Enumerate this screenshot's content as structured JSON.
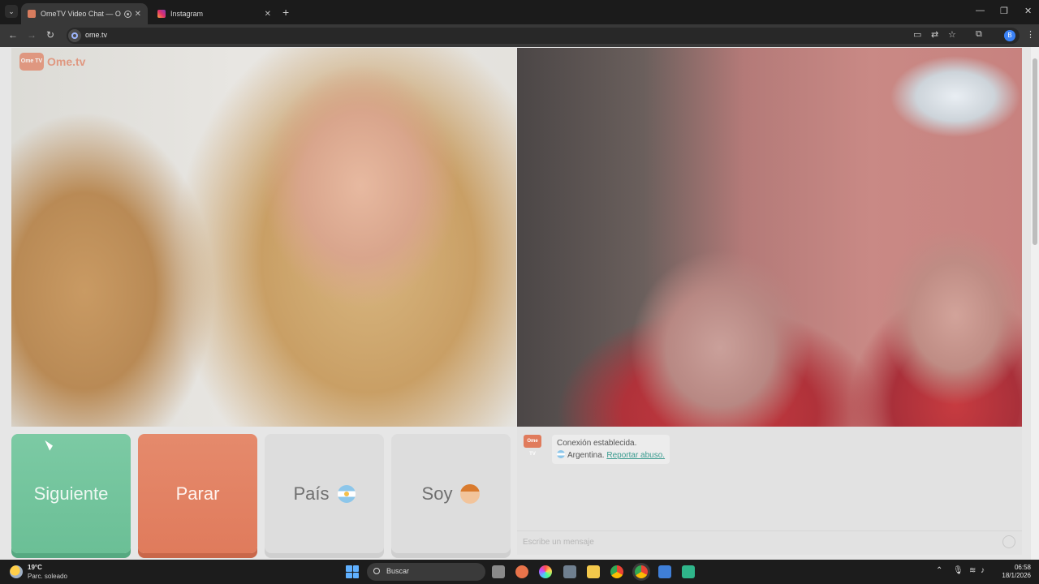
{
  "browser": {
    "tabs": [
      {
        "label": "OmeTV Video Chat — Omegle",
        "active": true
      },
      {
        "label": "Instagram",
        "active": false
      }
    ],
    "new_tab_symbol": "+",
    "url": "ome.tv",
    "profile_initial": "B"
  },
  "page": {
    "logo_text": "Ome.tv",
    "logo_badge": "Ome TV",
    "buttons": {
      "next": "Siguiente",
      "stop": "Parar",
      "country": "País",
      "gender": "Soy"
    },
    "chat": {
      "status": "Conexión establecida.",
      "country": "Argentina.",
      "report_link": "Reportar abuso.",
      "input_placeholder": "Escribe un mensaje"
    }
  },
  "taskbar": {
    "temperature": "19°C",
    "weather": "Parc. soleado",
    "search_placeholder": "Buscar",
    "time": "06:58",
    "date": "18/1/2026"
  },
  "colors": {
    "accent": "#e07b5c",
    "next_button": "#6bbf96",
    "stop_button": "#e07b5c",
    "link": "#3a9b8f"
  },
  "icons": [
    "search-icon",
    "close-icon",
    "record-icon",
    "back-icon",
    "forward-icon",
    "reload-icon",
    "cast-icon",
    "translate-icon",
    "star-icon",
    "extensions-icon",
    "menu-icon",
    "argentina-flag-icon",
    "boy-emoji-icon",
    "emoji-icon",
    "windows-start-icon",
    "wifi-icon",
    "volume-icon",
    "battery-icon"
  ]
}
